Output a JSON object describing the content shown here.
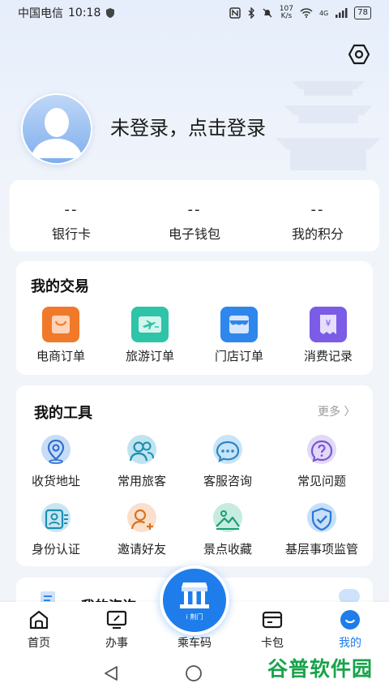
{
  "status_bar": {
    "carrier": "中国电信",
    "time": "10:18",
    "net_speed_value": "107",
    "net_speed_unit": "K/s",
    "network": "4G",
    "battery": "78"
  },
  "profile": {
    "login_prompt": "未登录，点击登录"
  },
  "stats": [
    {
      "value": "--",
      "label": "银行卡"
    },
    {
      "value": "--",
      "label": "电子钱包"
    },
    {
      "value": "--",
      "label": "我的积分"
    }
  ],
  "transactions": {
    "title": "我的交易",
    "items": [
      {
        "label": "电商订单",
        "icon": "shopping-bag-icon",
        "color": "#f07a2a"
      },
      {
        "label": "旅游订单",
        "icon": "plane-ticket-icon",
        "color": "#2fc3a8"
      },
      {
        "label": "门店订单",
        "icon": "store-icon",
        "color": "#2f86ec"
      },
      {
        "label": "消费记录",
        "icon": "receipt-icon",
        "color": "#7a5ce6"
      }
    ]
  },
  "tools": {
    "title": "我的工具",
    "more_label": "更多",
    "items": [
      {
        "label": "收货地址",
        "icon": "location-icon",
        "color": "#c7dcf7"
      },
      {
        "label": "常用旅客",
        "icon": "travelers-icon",
        "color": "#bfe4f0"
      },
      {
        "label": "客服咨询",
        "icon": "chat-icon",
        "color": "#c8e4f6"
      },
      {
        "label": "常见问题",
        "icon": "question-icon",
        "color": "#e2d9f7"
      },
      {
        "label": "身份认证",
        "icon": "id-card-icon",
        "color": "#c9e6f2"
      },
      {
        "label": "邀请好友",
        "icon": "invite-friend-icon",
        "color": "#fae0cc"
      },
      {
        "label": "景点收藏",
        "icon": "scenic-icon",
        "color": "#c6ebdf"
      },
      {
        "label": "基层事项监管",
        "icon": "shield-check-icon",
        "color": "#c7dff8"
      }
    ]
  },
  "consult": {
    "title": "我的咨询"
  },
  "bottom_nav": {
    "items": [
      {
        "label": "首页",
        "icon": "home-icon"
      },
      {
        "label": "办事",
        "icon": "monitor-icon"
      },
      {
        "label": "乘车码",
        "icon": "qr-bus-icon"
      },
      {
        "label": "卡包",
        "icon": "card-icon"
      },
      {
        "label": "我的",
        "icon": "profile-icon"
      }
    ],
    "active_color": "#1e7dea",
    "qr_badge_text": "i 荆门"
  },
  "watermark": "谷普软件园"
}
